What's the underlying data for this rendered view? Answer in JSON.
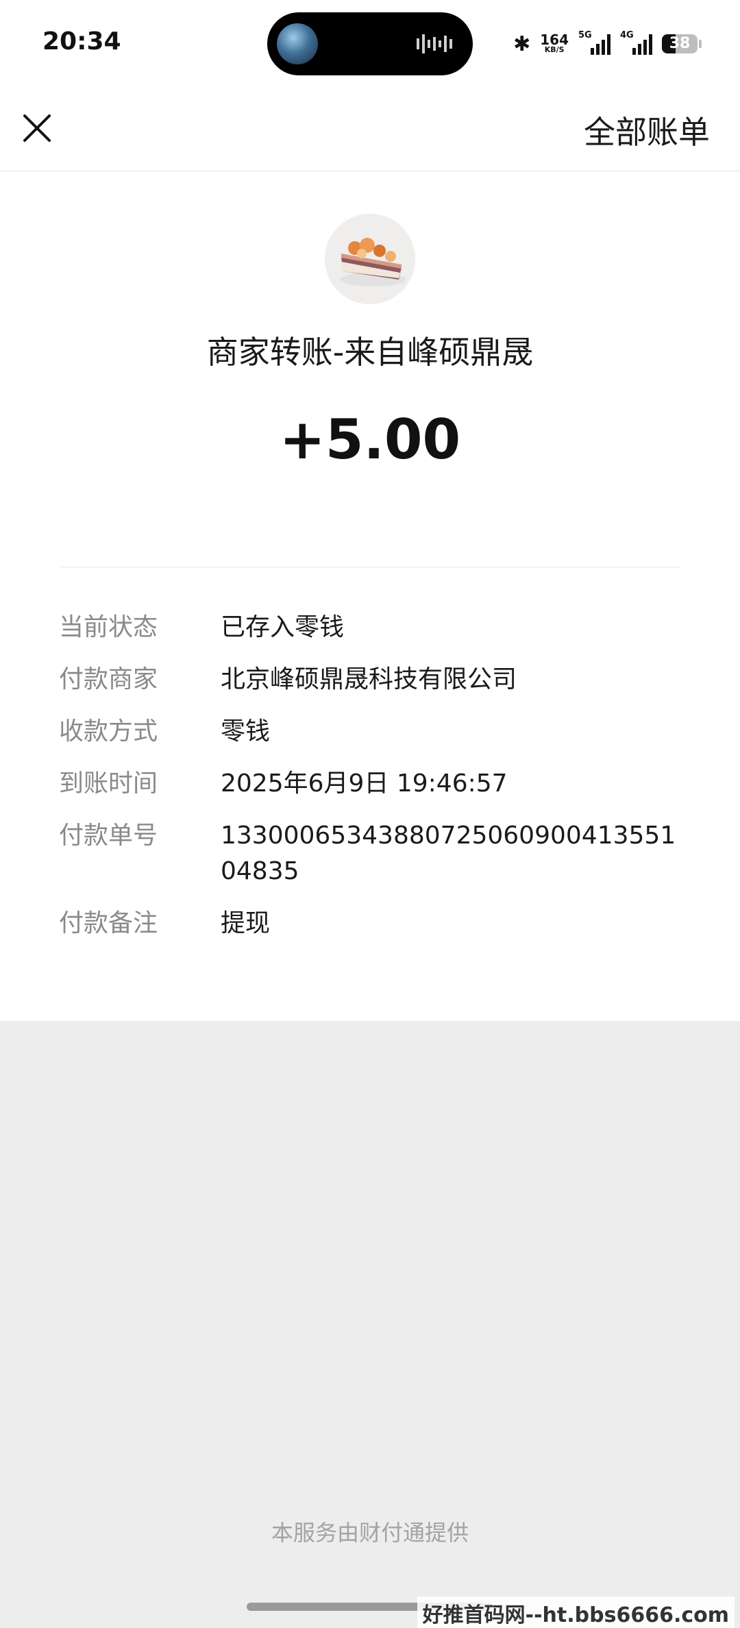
{
  "status_bar": {
    "time": "20:34",
    "net_speed_value": "164",
    "net_speed_unit": "KB/S",
    "signal_1_tag": "5G",
    "signal_2_tag": "4G",
    "battery_level": "38"
  },
  "nav": {
    "close_icon": "close-icon",
    "all_bills_label": "全部账单"
  },
  "merchant": {
    "avatar_icon": "cake-avatar",
    "title": "商家转账-来自峰硕鼎晟",
    "amount": "+5.00"
  },
  "details": [
    {
      "label": "当前状态",
      "value": "已存入零钱"
    },
    {
      "label": "付款商家",
      "value": "北京峰硕鼎晟科技有限公司"
    },
    {
      "label": "收款方式",
      "value": "零钱"
    },
    {
      "label": "到账时间",
      "value": "2025年6月9日 19:46:57"
    },
    {
      "label": "付款单号",
      "value": "1330006534388072506090041355104835"
    },
    {
      "label": "付款备注",
      "value": "提现"
    }
  ],
  "footer": {
    "service_note": "本服务由财付通提供"
  },
  "watermark": "好推首码网--ht.bbs6666.com"
}
